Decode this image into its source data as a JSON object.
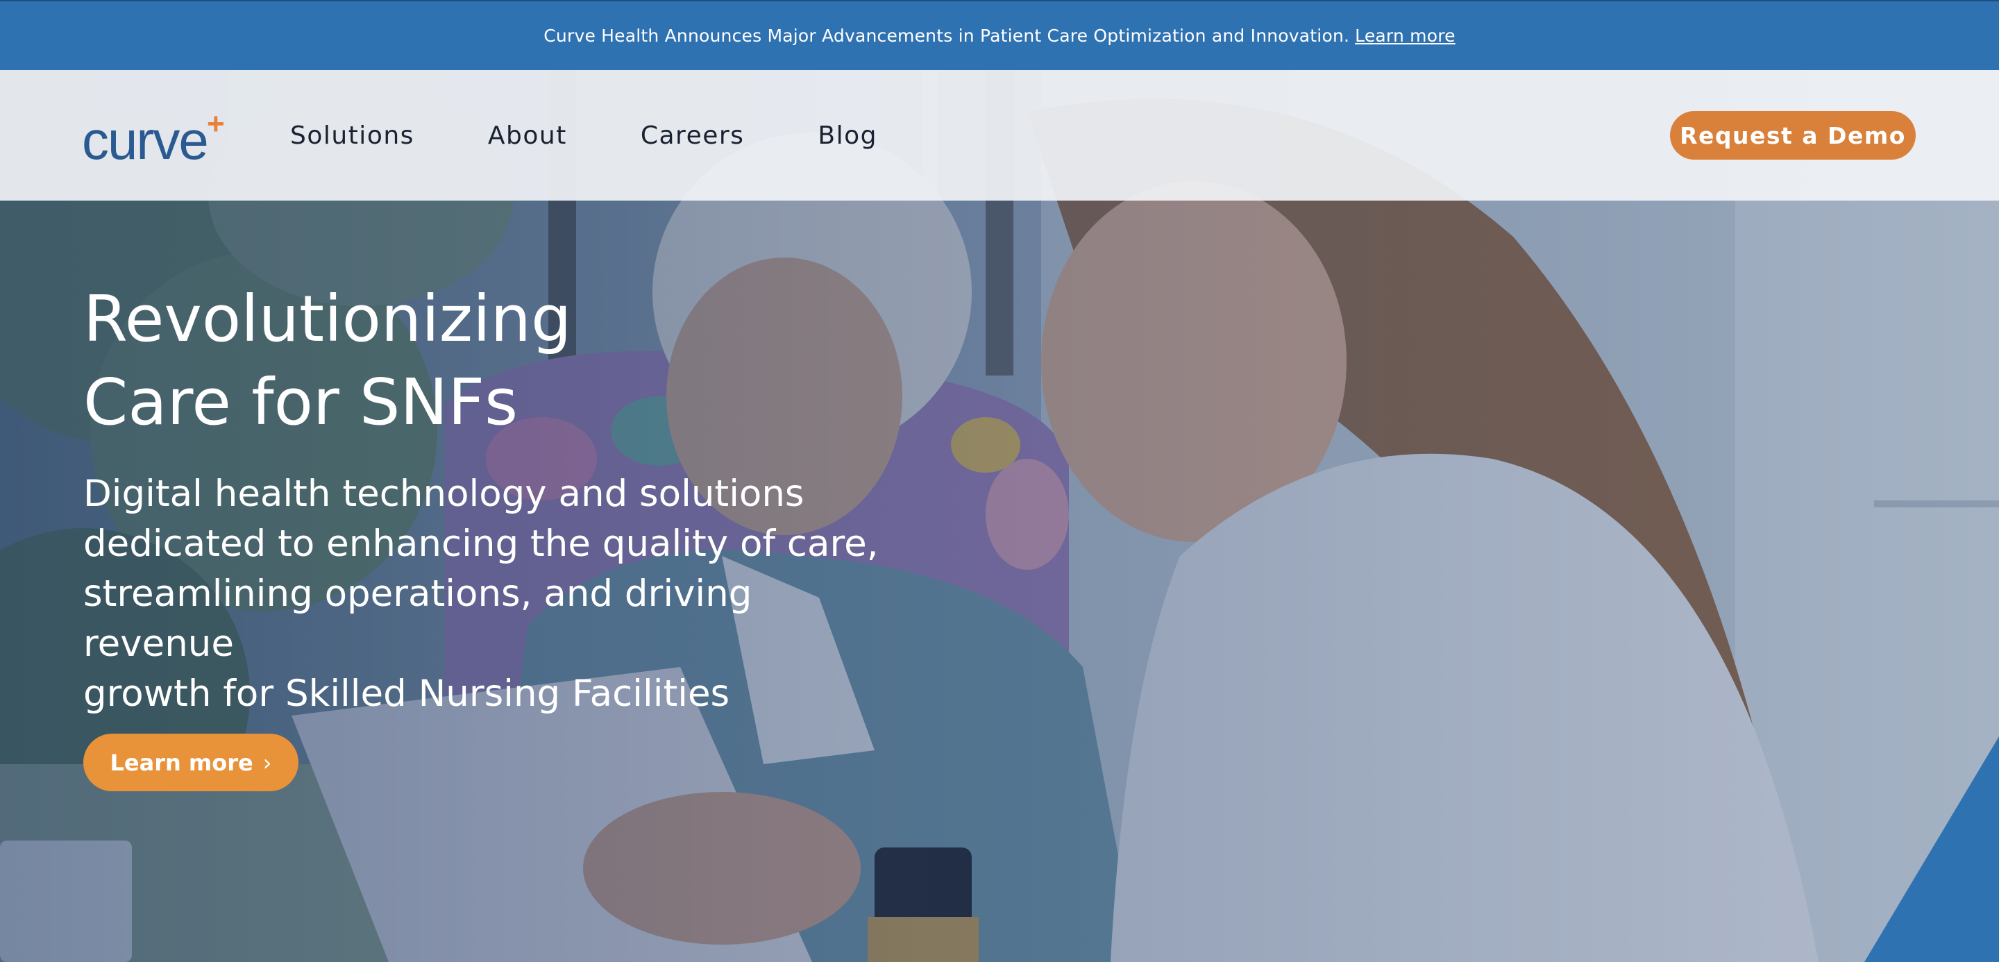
{
  "announcement": {
    "text": "Curve Health Announces Major Advancements in Patient Care Optimization and Innovation.",
    "link_label": "Learn more"
  },
  "brand": {
    "logo_text": "curve",
    "logo_accent": "+",
    "primary_color": "#2f72b2",
    "accent_color": "#e8923a"
  },
  "nav": {
    "items": [
      {
        "label": "Solutions"
      },
      {
        "label": "About"
      },
      {
        "label": "Careers"
      },
      {
        "label": "Blog"
      }
    ],
    "cta_label": "Request a Demo"
  },
  "hero": {
    "title_line1": "Revolutionizing",
    "title_line2": "Care for SNFs",
    "subtitle_line1": "Digital health technology and solutions",
    "subtitle_line2": "dedicated to enhancing the quality of care,",
    "subtitle_line3": "streamlining operations, and driving revenue",
    "subtitle_line4": "growth for Skilled Nursing Facilities",
    "button_label": "Learn more",
    "button_icon": "chevron-right-icon",
    "image": "photo-caregiver-with-elderly-woman-tablet"
  }
}
